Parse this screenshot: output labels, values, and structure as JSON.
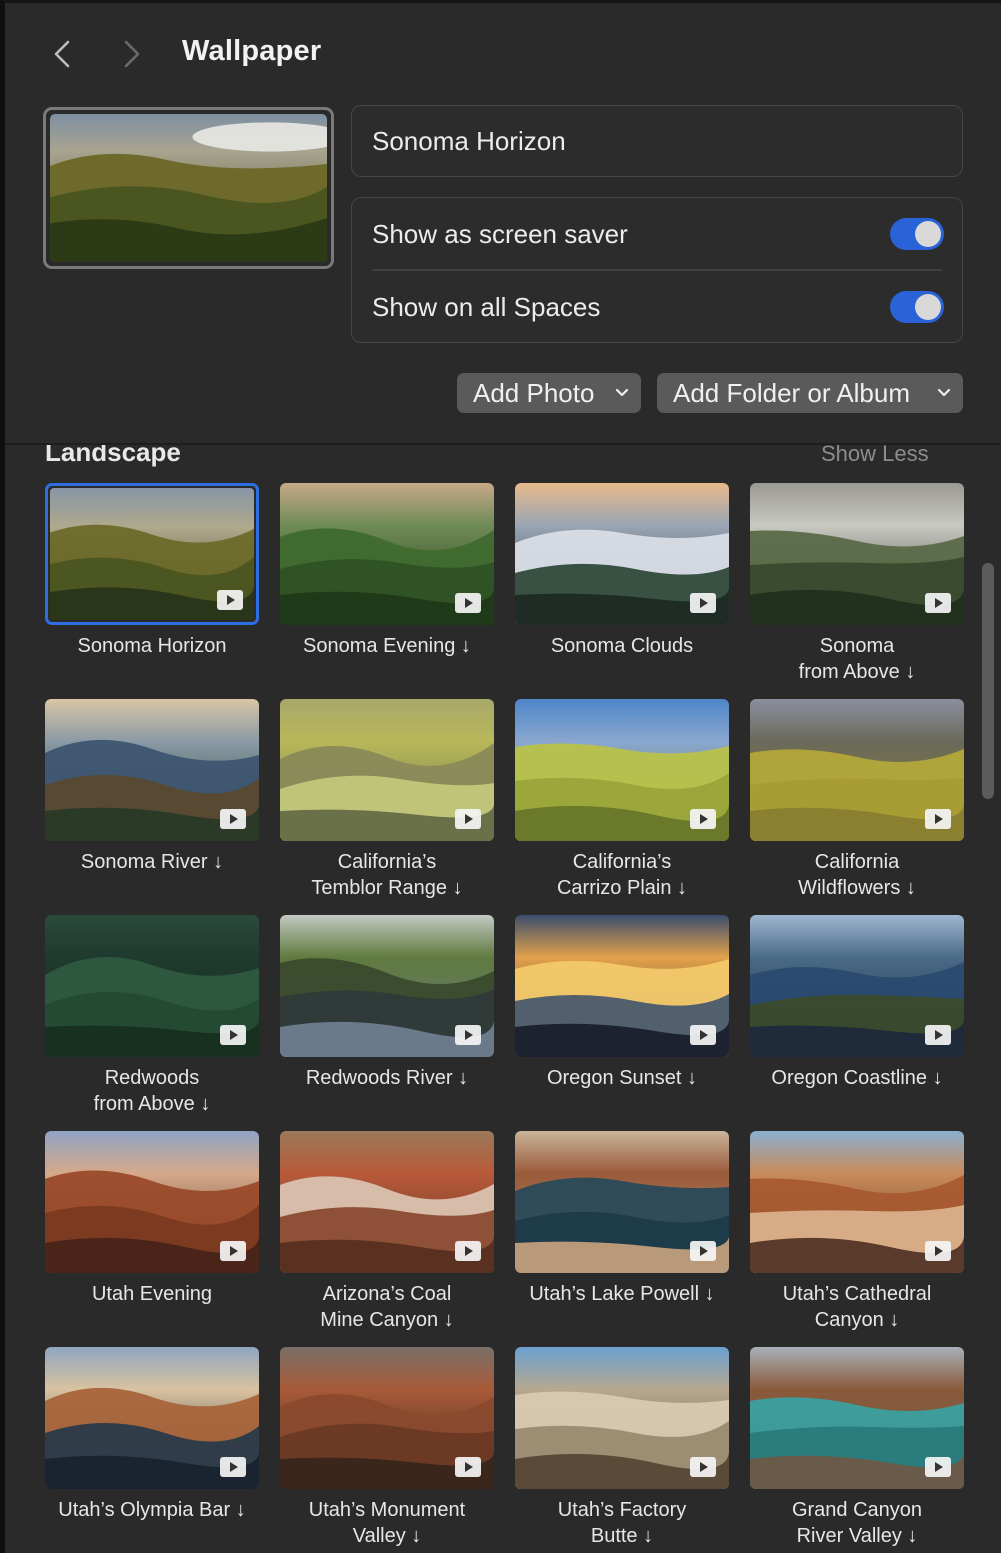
{
  "window": {
    "title": "Wallpaper"
  },
  "current": {
    "name": "Sonoma Horizon",
    "toggles": [
      {
        "label": "Show as screen saver",
        "on": true
      },
      {
        "label": "Show on all Spaces",
        "on": true
      }
    ]
  },
  "buttons": {
    "add_photo": "Add Photo",
    "add_folder": "Add Folder or Album"
  },
  "gallery": {
    "section": "Landscape",
    "show_less": "Show Less",
    "items": [
      {
        "line1": "Sonoma Horizon",
        "line2": ""
      },
      {
        "line1": "Sonoma Evening ↓",
        "line2": ""
      },
      {
        "line1": "Sonoma Clouds",
        "line2": ""
      },
      {
        "line1": "Sonoma",
        "line2": "from Above ↓"
      },
      {
        "line1": "Sonoma River ↓",
        "line2": ""
      },
      {
        "line1": "California’s",
        "line2": "Temblor Range ↓"
      },
      {
        "line1": "California’s",
        "line2": "Carrizo Plain ↓"
      },
      {
        "line1": "California",
        "line2": "Wildflowers ↓"
      },
      {
        "line1": "Redwoods",
        "line2": "from Above ↓"
      },
      {
        "line1": "Redwoods River ↓",
        "line2": ""
      },
      {
        "line1": "Oregon Sunset ↓",
        "line2": ""
      },
      {
        "line1": "Oregon Coastline ↓",
        "line2": ""
      },
      {
        "line1": "Utah Evening",
        "line2": ""
      },
      {
        "line1": "Arizona’s Coal",
        "line2": "Mine Canyon ↓"
      },
      {
        "line1": "Utah’s Lake Powell ↓",
        "line2": ""
      },
      {
        "line1": "Utah’s Cathedral",
        "line2": "Canyon ↓"
      },
      {
        "line1": "Utah’s Olympia Bar ↓",
        "line2": ""
      },
      {
        "line1": "Utah’s Monument",
        "line2": "Valley ↓"
      },
      {
        "line1": "Utah’s Factory",
        "line2": "Butte ↓"
      },
      {
        "line1": "Grand Canyon",
        "line2": "River Valley ↓"
      }
    ]
  },
  "icons": {
    "back": "chevron-left-icon",
    "forward": "chevron-right-icon",
    "dropdown": "chevron-down-icon",
    "video": "play-badge-icon"
  },
  "colors": {
    "accent": "#2a62d8",
    "background": "#2a2a2a"
  }
}
